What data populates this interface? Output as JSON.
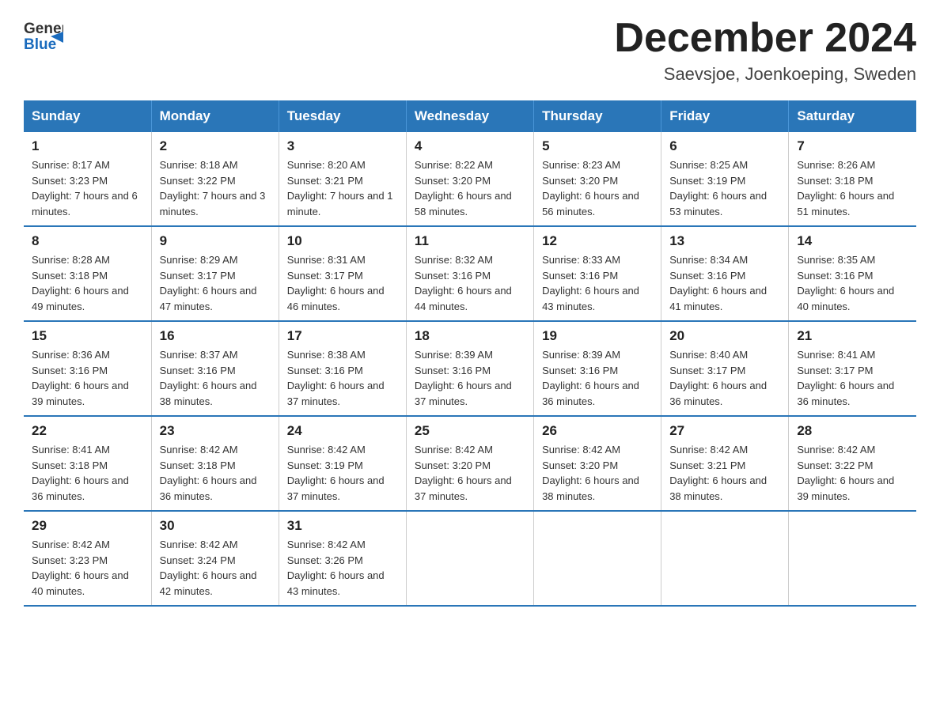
{
  "logo": {
    "text_general": "General",
    "text_blue": "Blue"
  },
  "header": {
    "month_title": "December 2024",
    "location": "Saevsjoe, Joenkoeping, Sweden"
  },
  "days_of_week": [
    "Sunday",
    "Monday",
    "Tuesday",
    "Wednesday",
    "Thursday",
    "Friday",
    "Saturday"
  ],
  "weeks": [
    [
      {
        "day": "1",
        "sunrise": "8:17 AM",
        "sunset": "3:23 PM",
        "daylight": "7 hours and 6 minutes."
      },
      {
        "day": "2",
        "sunrise": "8:18 AM",
        "sunset": "3:22 PM",
        "daylight": "7 hours and 3 minutes."
      },
      {
        "day": "3",
        "sunrise": "8:20 AM",
        "sunset": "3:21 PM",
        "daylight": "7 hours and 1 minute."
      },
      {
        "day": "4",
        "sunrise": "8:22 AM",
        "sunset": "3:20 PM",
        "daylight": "6 hours and 58 minutes."
      },
      {
        "day": "5",
        "sunrise": "8:23 AM",
        "sunset": "3:20 PM",
        "daylight": "6 hours and 56 minutes."
      },
      {
        "day": "6",
        "sunrise": "8:25 AM",
        "sunset": "3:19 PM",
        "daylight": "6 hours and 53 minutes."
      },
      {
        "day": "7",
        "sunrise": "8:26 AM",
        "sunset": "3:18 PM",
        "daylight": "6 hours and 51 minutes."
      }
    ],
    [
      {
        "day": "8",
        "sunrise": "8:28 AM",
        "sunset": "3:18 PM",
        "daylight": "6 hours and 49 minutes."
      },
      {
        "day": "9",
        "sunrise": "8:29 AM",
        "sunset": "3:17 PM",
        "daylight": "6 hours and 47 minutes."
      },
      {
        "day": "10",
        "sunrise": "8:31 AM",
        "sunset": "3:17 PM",
        "daylight": "6 hours and 46 minutes."
      },
      {
        "day": "11",
        "sunrise": "8:32 AM",
        "sunset": "3:16 PM",
        "daylight": "6 hours and 44 minutes."
      },
      {
        "day": "12",
        "sunrise": "8:33 AM",
        "sunset": "3:16 PM",
        "daylight": "6 hours and 43 minutes."
      },
      {
        "day": "13",
        "sunrise": "8:34 AM",
        "sunset": "3:16 PM",
        "daylight": "6 hours and 41 minutes."
      },
      {
        "day": "14",
        "sunrise": "8:35 AM",
        "sunset": "3:16 PM",
        "daylight": "6 hours and 40 minutes."
      }
    ],
    [
      {
        "day": "15",
        "sunrise": "8:36 AM",
        "sunset": "3:16 PM",
        "daylight": "6 hours and 39 minutes."
      },
      {
        "day": "16",
        "sunrise": "8:37 AM",
        "sunset": "3:16 PM",
        "daylight": "6 hours and 38 minutes."
      },
      {
        "day": "17",
        "sunrise": "8:38 AM",
        "sunset": "3:16 PM",
        "daylight": "6 hours and 37 minutes."
      },
      {
        "day": "18",
        "sunrise": "8:39 AM",
        "sunset": "3:16 PM",
        "daylight": "6 hours and 37 minutes."
      },
      {
        "day": "19",
        "sunrise": "8:39 AM",
        "sunset": "3:16 PM",
        "daylight": "6 hours and 36 minutes."
      },
      {
        "day": "20",
        "sunrise": "8:40 AM",
        "sunset": "3:17 PM",
        "daylight": "6 hours and 36 minutes."
      },
      {
        "day": "21",
        "sunrise": "8:41 AM",
        "sunset": "3:17 PM",
        "daylight": "6 hours and 36 minutes."
      }
    ],
    [
      {
        "day": "22",
        "sunrise": "8:41 AM",
        "sunset": "3:18 PM",
        "daylight": "6 hours and 36 minutes."
      },
      {
        "day": "23",
        "sunrise": "8:42 AM",
        "sunset": "3:18 PM",
        "daylight": "6 hours and 36 minutes."
      },
      {
        "day": "24",
        "sunrise": "8:42 AM",
        "sunset": "3:19 PM",
        "daylight": "6 hours and 37 minutes."
      },
      {
        "day": "25",
        "sunrise": "8:42 AM",
        "sunset": "3:20 PM",
        "daylight": "6 hours and 37 minutes."
      },
      {
        "day": "26",
        "sunrise": "8:42 AM",
        "sunset": "3:20 PM",
        "daylight": "6 hours and 38 minutes."
      },
      {
        "day": "27",
        "sunrise": "8:42 AM",
        "sunset": "3:21 PM",
        "daylight": "6 hours and 38 minutes."
      },
      {
        "day": "28",
        "sunrise": "8:42 AM",
        "sunset": "3:22 PM",
        "daylight": "6 hours and 39 minutes."
      }
    ],
    [
      {
        "day": "29",
        "sunrise": "8:42 AM",
        "sunset": "3:23 PM",
        "daylight": "6 hours and 40 minutes."
      },
      {
        "day": "30",
        "sunrise": "8:42 AM",
        "sunset": "3:24 PM",
        "daylight": "6 hours and 42 minutes."
      },
      {
        "day": "31",
        "sunrise": "8:42 AM",
        "sunset": "3:26 PM",
        "daylight": "6 hours and 43 minutes."
      },
      {
        "day": "",
        "sunrise": "",
        "sunset": "",
        "daylight": ""
      },
      {
        "day": "",
        "sunrise": "",
        "sunset": "",
        "daylight": ""
      },
      {
        "day": "",
        "sunrise": "",
        "sunset": "",
        "daylight": ""
      },
      {
        "day": "",
        "sunrise": "",
        "sunset": "",
        "daylight": ""
      }
    ]
  ]
}
